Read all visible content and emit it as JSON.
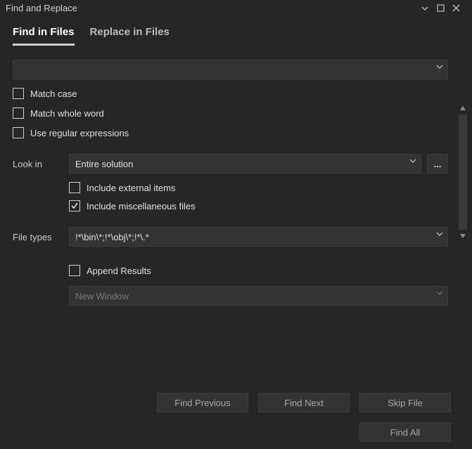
{
  "window": {
    "title": "Find and Replace"
  },
  "tabs": {
    "find": "Find in Files",
    "replace": "Replace in Files"
  },
  "options": {
    "match_case": "Match case",
    "match_whole_word": "Match whole word",
    "use_regex": "Use regular expressions",
    "include_external": "Include external items",
    "include_misc": "Include miscellaneous files",
    "append_results": "Append Results"
  },
  "labels": {
    "look_in": "Look in",
    "file_types": "File types"
  },
  "values": {
    "look_in": "Entire solution",
    "file_types": "!*\\bin\\*;!*\\obj\\*;!*\\.*",
    "result_target": "New Window"
  },
  "buttons": {
    "browse": "...",
    "find_prev": "Find Previous",
    "find_next": "Find Next",
    "skip_file": "Skip File",
    "find_all": "Find All"
  }
}
